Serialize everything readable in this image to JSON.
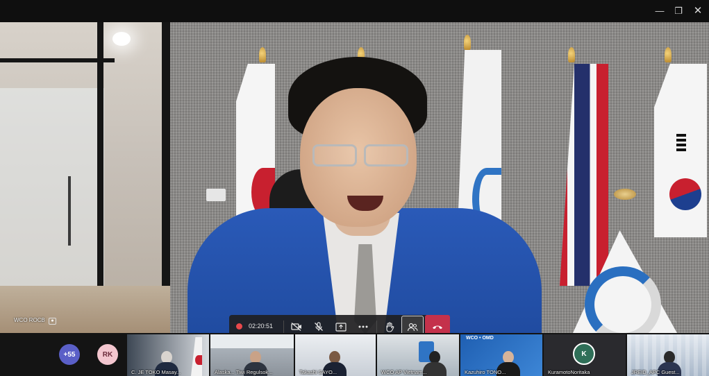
{
  "stage": {
    "participant_label": "WCO ROCB"
  },
  "controls": {
    "call_timer": "02:20:51"
  },
  "strip": {
    "overflow_count": "+55",
    "overflow_color": "#5a5fc7",
    "rk_initials": "RK",
    "rk_color": "#f3c6cf",
    "tiles": [
      {
        "name": "C. JE   TOKO Masay..."
      },
      {
        "name": "Alaska... Tiwi Regulsok..."
      },
      {
        "name": "Takashi SAYO..."
      },
      {
        "name": "WCO AP Vietnam..."
      },
      {
        "name": "Kazuhiro TONO..."
      },
      {
        "name": "KuramotoNoritaka"
      },
      {
        "name": "JREID_APC Guest..."
      }
    ],
    "k_initial": "K",
    "wco_banner": "WCO • OMD"
  }
}
